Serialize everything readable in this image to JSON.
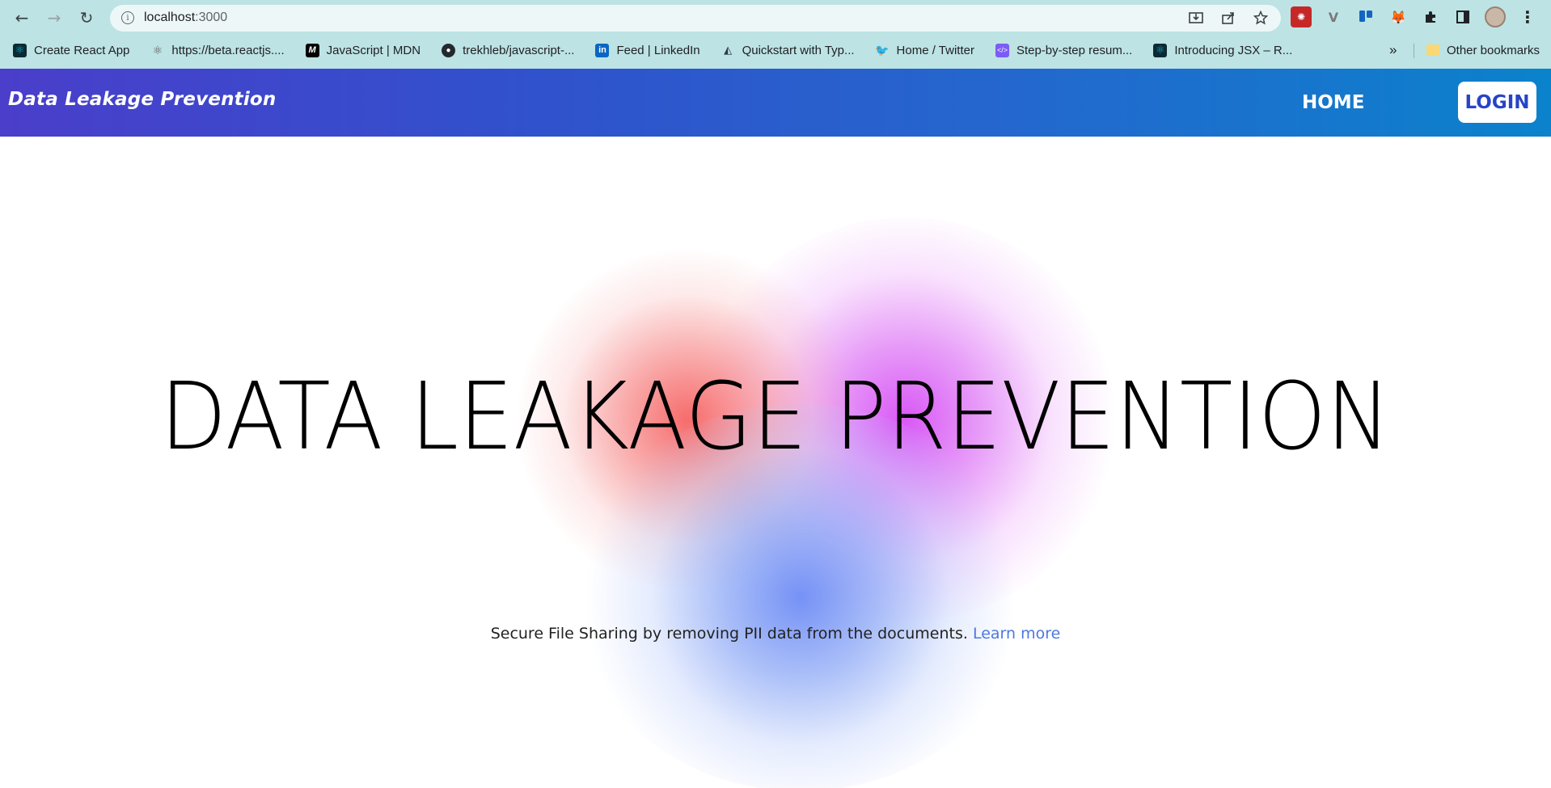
{
  "browser": {
    "url_host": "localhost",
    "url_port": ":3000",
    "nav": {
      "back_icon": "←",
      "forward_icon": "→",
      "reload_icon": "↻"
    },
    "bookmarks": [
      {
        "label": "Create React App",
        "icon": "react-icon"
      },
      {
        "label": "https://beta.reactjs....",
        "icon": "react-atom-icon"
      },
      {
        "label": "JavaScript | MDN",
        "icon": "mdn-icon"
      },
      {
        "label": "trekhleb/javascript-...",
        "icon": "github-icon"
      },
      {
        "label": "Feed | LinkedIn",
        "icon": "linkedin-icon"
      },
      {
        "label": "Quickstart with Typ...",
        "icon": "prisma-icon"
      },
      {
        "label": "Home / Twitter",
        "icon": "twitter-icon"
      },
      {
        "label": "Step-by-step resum...",
        "icon": "code-icon"
      },
      {
        "label": "Introducing JSX – R...",
        "icon": "react-icon"
      }
    ],
    "bookmarks_more": "»",
    "other_bookmarks": "Other bookmarks"
  },
  "header": {
    "brand": "Data Leakage Prevention",
    "nav_home": "HOME",
    "nav_login": "LOGIN",
    "colors": {
      "gradient_start": "#4a3ecb",
      "gradient_end": "#0b82cc",
      "login_text": "#2744c6"
    }
  },
  "hero": {
    "title": "DATA LEAKAGE PREVENTION",
    "tagline": "Secure File Sharing by removing PII data from the documents.",
    "learn_more": "Learn more",
    "colors": {
      "blob_red": "#f66464",
      "blob_purple": "#d750f5",
      "blob_blue": "#6e8cf5",
      "link": "#4d78e0"
    }
  }
}
